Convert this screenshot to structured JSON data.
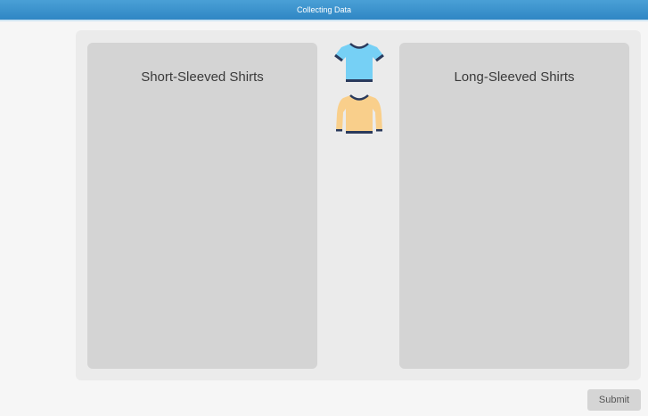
{
  "header": {
    "title": "Collecting Data"
  },
  "bins": {
    "left": {
      "label": "Short-Sleeved Shirts"
    },
    "right": {
      "label": "Long-Sleeved Shirts"
    }
  },
  "items": [
    {
      "kind": "short-sleeve-shirt",
      "color": "#76d0f5",
      "trim": "#2a3a5c"
    },
    {
      "kind": "long-sleeve-shirt",
      "color": "#f9cf8b",
      "trim": "#2a3a5c"
    }
  ],
  "actions": {
    "submit_label": "Submit"
  }
}
